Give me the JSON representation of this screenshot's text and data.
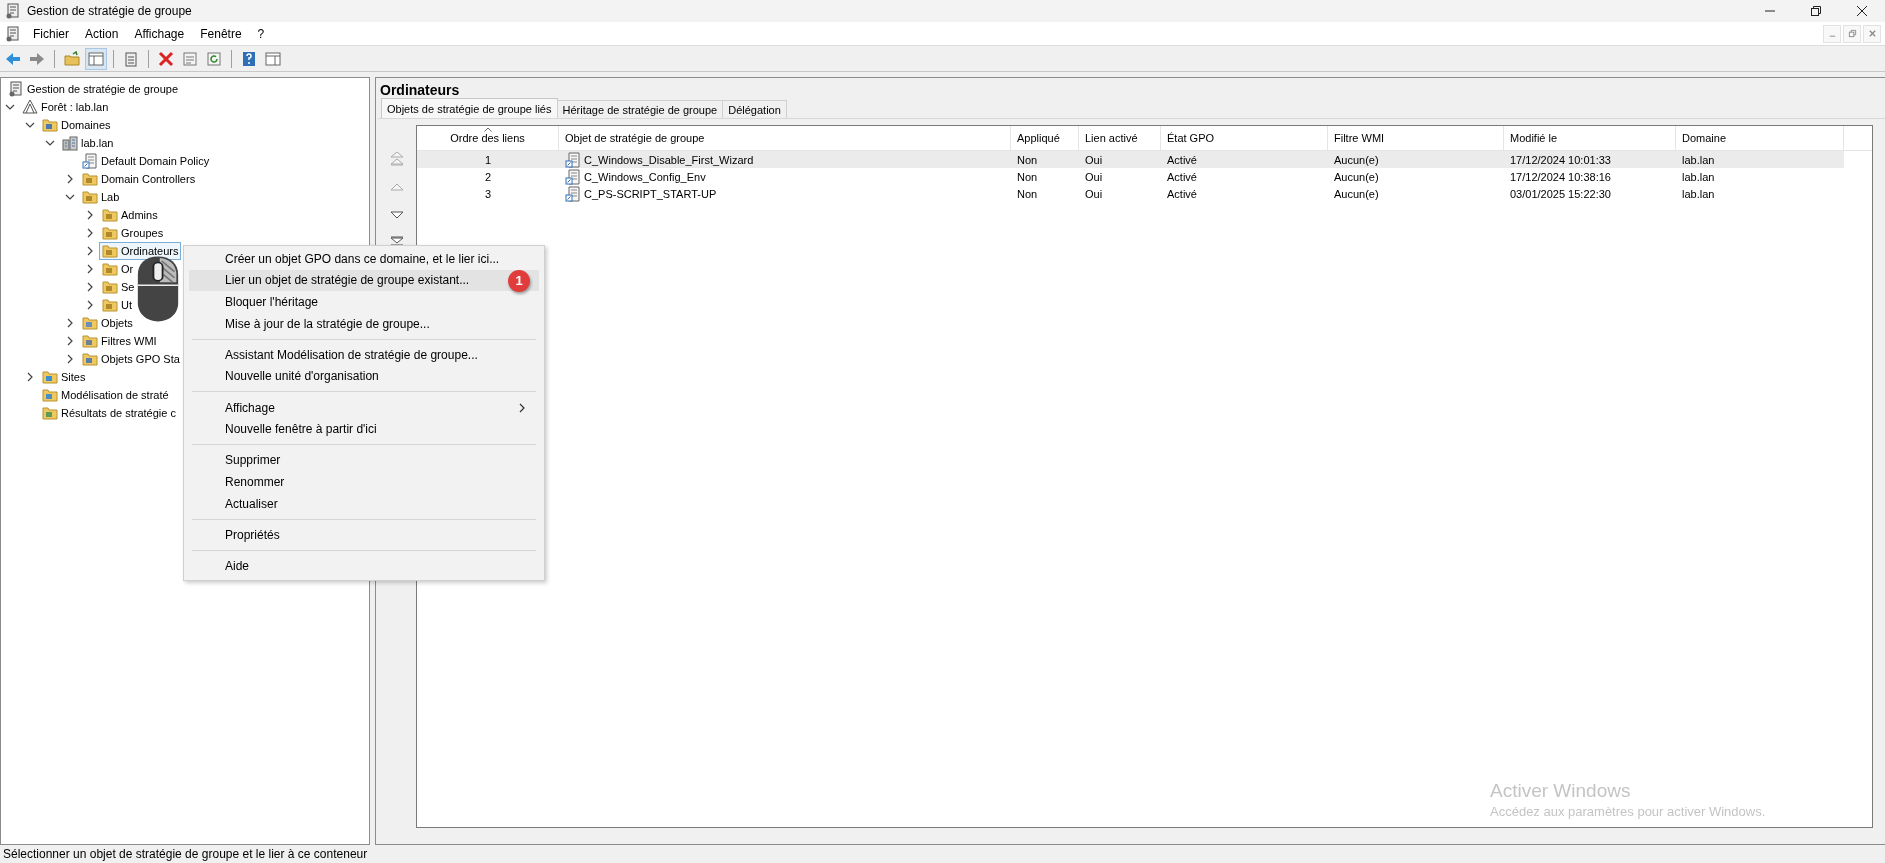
{
  "window": {
    "title": "Gestion de stratégie de groupe"
  },
  "menu_bar": [
    "Fichier",
    "Action",
    "Affichage",
    "Fenêtre",
    "?"
  ],
  "console_root": {
    "label": "Gestion de stratégie de groupe"
  },
  "tree": [
    {
      "label": "Forêt : lab.lan",
      "kind": "forest",
      "expanded": true,
      "selected": false,
      "children": [
        {
          "label": "Domaines",
          "kind": "domains",
          "expanded": true,
          "selected": false,
          "children": [
            {
              "label": "lab.lan",
              "kind": "domain",
              "expanded": true,
              "selected": false,
              "children": [
                {
                  "label": "Default Domain Policy",
                  "kind": "gpo",
                  "selected": false
                },
                {
                  "label": "Domain Controllers",
                  "kind": "ou",
                  "expanded": false,
                  "selected": false
                },
                {
                  "label": "Lab",
                  "kind": "ou",
                  "expanded": true,
                  "selected": false,
                  "children": [
                    {
                      "label": "Admins",
                      "kind": "ou",
                      "expanded": false,
                      "selected": false
                    },
                    {
                      "label": "Groupes",
                      "kind": "ou",
                      "expanded": false,
                      "selected": false
                    },
                    {
                      "label": "Ordinateurs",
                      "kind": "ou",
                      "expanded": false,
                      "selected": true
                    },
                    {
                      "label": "Or",
                      "kind": "ou",
                      "expanded": false,
                      "selected": false
                    },
                    {
                      "label": "Se",
                      "kind": "ou",
                      "expanded": false,
                      "selected": false
                    },
                    {
                      "label": "Ut",
                      "kind": "ou",
                      "expanded": false,
                      "selected": false
                    }
                  ]
                },
                {
                  "label": "Objets",
                  "kind": "gpos",
                  "expanded": false,
                  "selected": false
                },
                {
                  "label": "Filtres WMI",
                  "kind": "wmi",
                  "expanded": false,
                  "selected": false
                },
                {
                  "label": "Objets GPO Sta",
                  "kind": "starter",
                  "expanded": false,
                  "selected": false
                }
              ]
            }
          ]
        },
        {
          "label": "Sites",
          "kind": "sites",
          "expanded": false,
          "selected": false
        },
        {
          "label": "Modélisation de straté",
          "kind": "modeling",
          "selected": false
        },
        {
          "label": "Résultats de stratégie c",
          "kind": "results",
          "selected": false
        }
      ]
    }
  ],
  "details": {
    "title": "Ordinateurs",
    "tabs": [
      {
        "label": "Objets de stratégie de groupe liés",
        "selected": true
      },
      {
        "label": "Héritage de stratégie de groupe",
        "selected": false
      },
      {
        "label": "Délégation",
        "selected": false
      }
    ],
    "order_buttons": [
      {
        "kind": "top",
        "disabled": true
      },
      {
        "kind": "up",
        "disabled": true
      },
      {
        "kind": "down",
        "disabled": false
      },
      {
        "kind": "bottom",
        "disabled": false
      }
    ],
    "table": {
      "columns": [
        {
          "label": "Ordre des liens",
          "sorted": true
        },
        {
          "label": "Objet de stratégie de groupe",
          "sorted": false
        },
        {
          "label": "Appliqué",
          "sorted": false
        },
        {
          "label": "Lien activé",
          "sorted": false
        },
        {
          "label": "État GPO",
          "sorted": false
        },
        {
          "label": "Filtre WMI",
          "sorted": false
        },
        {
          "label": "Modifié le",
          "sorted": false
        },
        {
          "label": "Domaine",
          "sorted": false
        }
      ],
      "rows": [
        {
          "selected": true,
          "cells": [
            "1",
            "C_Windows_Disable_First_Wizard",
            "Non",
            "Oui",
            "Activé",
            "Aucun(e)",
            "17/12/2024 10:01:33",
            "lab.lan"
          ]
        },
        {
          "selected": false,
          "cells": [
            "2",
            "C_Windows_Config_Env",
            "Non",
            "Oui",
            "Activé",
            "Aucun(e)",
            "17/12/2024 10:38:16",
            "lab.lan"
          ]
        },
        {
          "selected": false,
          "cells": [
            "3",
            "C_PS-SCRIPT_START-UP",
            "Non",
            "Oui",
            "Activé",
            "Aucun(e)",
            "03/01/2025 15:22:30",
            "lab.lan"
          ]
        }
      ]
    }
  },
  "context_menu": [
    {
      "kind": "item",
      "label": "Créer un objet GPO dans ce domaine, et le lier ici...",
      "selected": false
    },
    {
      "kind": "item",
      "label": "Lier un objet de stratégie de groupe existant...",
      "selected": true,
      "badge": "1"
    },
    {
      "kind": "item",
      "label": "Bloquer l'héritage",
      "selected": false
    },
    {
      "kind": "item",
      "label": "Mise à jour de la stratégie de groupe...",
      "selected": false
    },
    {
      "kind": "separator"
    },
    {
      "kind": "item",
      "label": "Assistant Modélisation de stratégie de groupe...",
      "selected": false
    },
    {
      "kind": "item",
      "label": "Nouvelle unité d'organisation",
      "selected": false
    },
    {
      "kind": "separator"
    },
    {
      "kind": "item",
      "label": "Affichage",
      "selected": false,
      "submenu": true
    },
    {
      "kind": "item",
      "label": "Nouvelle fenêtre à partir d'ici",
      "selected": false
    },
    {
      "kind": "separator"
    },
    {
      "kind": "item",
      "label": "Supprimer",
      "selected": false
    },
    {
      "kind": "item",
      "label": "Renommer",
      "selected": false
    },
    {
      "kind": "item",
      "label": "Actualiser",
      "selected": false
    },
    {
      "kind": "separator"
    },
    {
      "kind": "item",
      "label": "Propriétés",
      "selected": false
    },
    {
      "kind": "separator"
    },
    {
      "kind": "item",
      "label": "Aide",
      "selected": false
    }
  ],
  "activation_notice": {
    "title": "Activer Windows",
    "text": "Accédez aux paramètres pour activer Windows."
  },
  "status_bar": "Sélectionner un objet de stratégie de groupe et le lier à ce conteneur"
}
